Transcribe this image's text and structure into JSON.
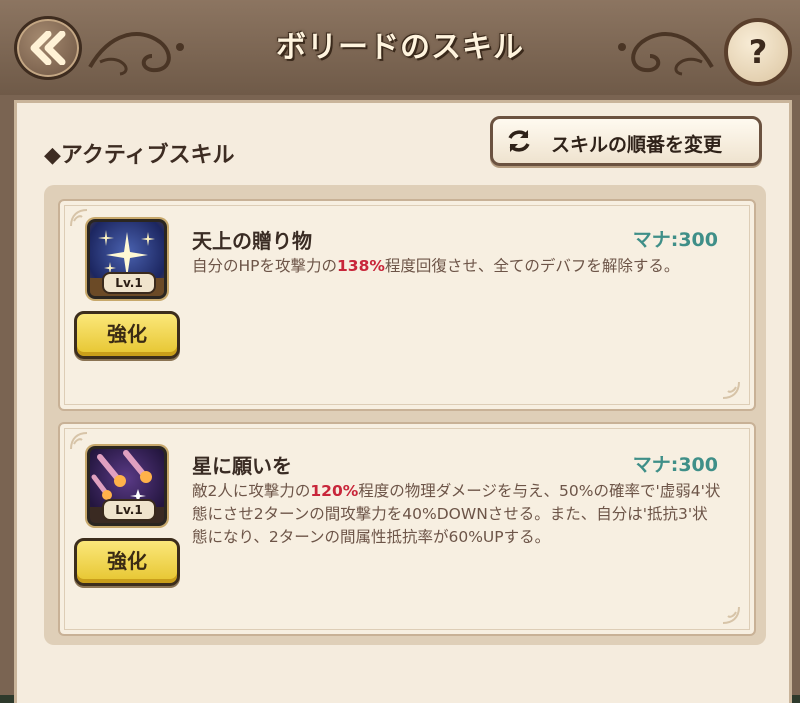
{
  "header": {
    "title": "ボリードのスキル",
    "back_icon": "double-chevron-left-icon",
    "help_label": "?"
  },
  "section": {
    "title": "◆アクティブスキル",
    "order_button_label": "スキルの順番を変更",
    "order_icon": "refresh-icon"
  },
  "skills": [
    {
      "name": "天上の贈り物",
      "mana": "マナ:300",
      "level": "Lv.1",
      "upgrade_label": "強化",
      "icon": "starlight-icon",
      "desc_parts": [
        "自分のHPを攻撃力の",
        "138%",
        "程度回復させ、全てのデバフを解除する。"
      ]
    },
    {
      "name": "星に願いを",
      "mana": "マナ:300",
      "level": "Lv.1",
      "upgrade_label": "強化",
      "icon": "meteor-icon",
      "desc_parts": [
        "敵2人に攻撃力の",
        "120%",
        "程度の物理ダメージを与え、50%の確率で'虚弱4'状態にさせ2ターンの間攻撃力を40%DOWNさせる。また、自分は'抵抗3'状態になり、2ターンの間属性抵抗率が60%UPする。"
      ]
    }
  ],
  "colors": {
    "mana": "#3f8f88",
    "highlight": "#c8263a",
    "upgrade_button": "#f0d24a"
  }
}
